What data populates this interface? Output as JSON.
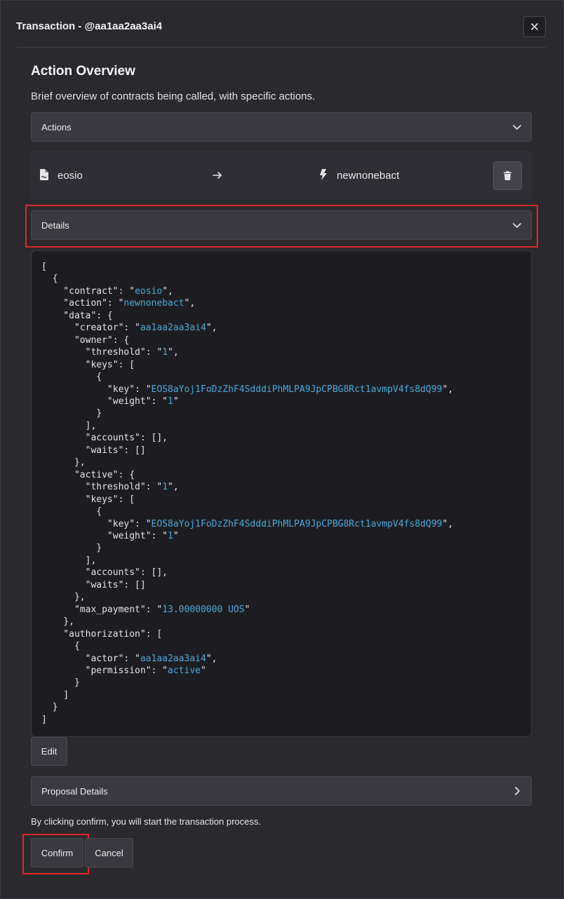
{
  "dialog": {
    "title": "Transaction - @aa1aa2aa3ai4",
    "close_icon": "close-icon"
  },
  "overview": {
    "title": "Action Overview",
    "subtitle": "Brief overview of contracts being called, with specific actions."
  },
  "actions_accordion": {
    "label": "Actions",
    "icon": "chevron-down-icon"
  },
  "action_row": {
    "contract": "eosio",
    "contract_icon": "file-contract-icon",
    "arrow_icon": "arrow-right-icon",
    "action": "newnonebact",
    "action_icon": "bolt-icon",
    "delete_icon": "trash-icon"
  },
  "details_accordion": {
    "label": "Details",
    "icon": "chevron-down-icon"
  },
  "details_json": {
    "contract": "eosio",
    "action": "newnonebact",
    "creator": "aa1aa2aa3ai4",
    "owner_threshold": "1",
    "owner_key": "EOS8aYoj1FoDzZhF4SdddiPhMLPA9JpCPBG8Rct1avmpV4fs8dQ99",
    "owner_weight": "1",
    "active_threshold": "1",
    "active_key": "EOS8aYoj1FoDzZhF4SdddiPhMLPA9JpCPBG8Rct1avmpV4fs8dQ99",
    "active_weight": "1",
    "max_payment": "13.00000000 UOS",
    "actor": "aa1aa2aa3ai4",
    "permission": "active"
  },
  "edit_button": {
    "label": "Edit"
  },
  "proposal_accordion": {
    "label": "Proposal Details",
    "icon": "chevron-right-icon"
  },
  "footer": {
    "note": "By clicking confirm, you will start the transaction process.",
    "confirm_label": "Confirm",
    "cancel_label": "Cancel"
  },
  "colors": {
    "background": "#2a292e",
    "panel": "#3a3940",
    "string": "#4aa8d8",
    "highlight": "#e0262b"
  }
}
